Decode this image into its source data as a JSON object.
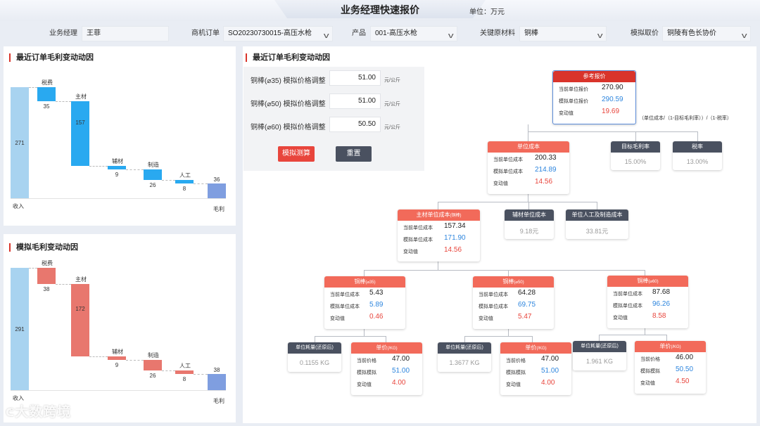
{
  "header": {
    "title": "业务经理快速报价",
    "unit": "单位：万元"
  },
  "filters": {
    "manager_label": "业务经理",
    "manager_value": "王菲",
    "order_label": "商机订单",
    "order_value": "SO20230730015-高压水枪",
    "product_label": "产品",
    "product_value": "001-高压水枪",
    "material_label": "关键原材料",
    "material_value": "铜棒",
    "price_label": "模拟取价",
    "price_value": "铜陵有色长协价"
  },
  "chart1": {
    "title": "最近订单毛利变动动因"
  },
  "chart2": {
    "title": "模拟毛利变动动因"
  },
  "chart_data": [
    {
      "type": "bar",
      "title": "最近订单毛利变动动因",
      "categories": [
        "收入",
        "税费",
        "主材",
        "辅材",
        "制造",
        "人工",
        "毛利"
      ],
      "values": [
        271,
        35,
        157,
        9,
        26,
        8,
        36
      ]
    },
    {
      "type": "bar",
      "title": "模拟毛利变动动因",
      "categories": [
        "收入",
        "税费",
        "主材",
        "辅材",
        "制造",
        "人工",
        "毛利"
      ],
      "values": [
        291,
        38,
        172,
        9,
        26,
        8,
        38
      ]
    }
  ],
  "sim": {
    "title": "最近订单毛利变动动因",
    "rows": [
      {
        "label": "铜棒(⌀35)  模拟价格调整",
        "value": "51.00",
        "unit": "元/公斤"
      },
      {
        "label": "铜棒(⌀50)  模拟价格调整",
        "value": "51.00",
        "unit": "元/公斤"
      },
      {
        "label": "铜棒(⌀60)  模拟价格调整",
        "value": "50.50",
        "unit": "元/公斤"
      }
    ],
    "btn_sim": "模拟测算",
    "btn_reset": "重置"
  },
  "tree": {
    "ref": {
      "title": "参考报价",
      "k1": "当前单位报价",
      "v1": "270.90",
      "k2": "模拟单位报价",
      "v2": "290.59",
      "k3": "变动值",
      "v3": "19.69"
    },
    "formula": "（单位成本/（1-目标毛利率））/（1-税率）",
    "unit_cost": {
      "title": "单位成本",
      "k1": "当前单位成本",
      "v1": "200.33",
      "k2": "模拟单位成本",
      "v2": "214.89",
      "k3": "变动值",
      "v3": "14.56"
    },
    "margin": {
      "title": "目标毛利率",
      "value": "15.00%"
    },
    "tax": {
      "title": "税率",
      "value": "13.00%"
    },
    "main": {
      "title": "主材单位成本",
      "sub": "(铜棒)",
      "k1": "当前单位成本",
      "v1": "157.34",
      "k2": "模拟单位成本",
      "v2": "171.90",
      "k3": "变动值",
      "v3": "14.56"
    },
    "aux": {
      "title": "辅材单位成本",
      "value": "9.18元"
    },
    "labor": {
      "title": "单位人工及制造成本",
      "value": "33.81元"
    },
    "c35": {
      "title": "铜棒",
      "sub": "(⌀35)",
      "k1": "当前单位成本",
      "v1": "5.43",
      "k2": "模拟单位成本",
      "v2": "5.89",
      "k3": "变动值",
      "v3": "0.46",
      "use_title": "单位耗量(还原后)",
      "use": "0.1155 KG",
      "price_title": "单价",
      "price_sub": "(/KG)",
      "pk1": "当前价格",
      "pv1": "47.00",
      "pk2": "模拟模拟",
      "pv2": "51.00",
      "pk3": "变动值",
      "pv3": "4.00"
    },
    "c50": {
      "title": "铜棒",
      "sub": "(⌀50)",
      "k1": "当前单位成本",
      "v1": "64.28",
      "k2": "模拟单位成本",
      "v2": "69.75",
      "k3": "变动值",
      "v3": "5.47",
      "use_title": "单位耗量(还原后)",
      "use": "1.3677 KG",
      "price_title": "单价",
      "price_sub": "(/KG)",
      "pk1": "当前价格",
      "pv1": "47.00",
      "pk2": "模拟模拟",
      "pv2": "51.00",
      "pk3": "变动值",
      "pv3": "4.00"
    },
    "c60": {
      "title": "铜棒",
      "sub": "(⌀60)",
      "k1": "当前单位成本",
      "v1": "87.68",
      "k2": "模拟单位成本",
      "v2": "96.26",
      "k3": "变动值",
      "v3": "8.58",
      "use_title": "单位耗量(还原后)",
      "use": "1.961 KG",
      "price_title": "单价",
      "price_sub": "(/KG)",
      "pk1": "当前价格",
      "pv1": "46.00",
      "pk2": "模拟模拟",
      "pv2": "50.50",
      "pk3": "变动值",
      "pv3": "4.50"
    }
  },
  "watermark": "大数跨境",
  "colors": {
    "accent": "#d9342b",
    "blue": "#2e86de",
    "bar_blue": "#29a9f0",
    "bar_red": "#e8776e",
    "bar_light": "#a8d3f0",
    "bar_total": "#7f9ee0"
  }
}
